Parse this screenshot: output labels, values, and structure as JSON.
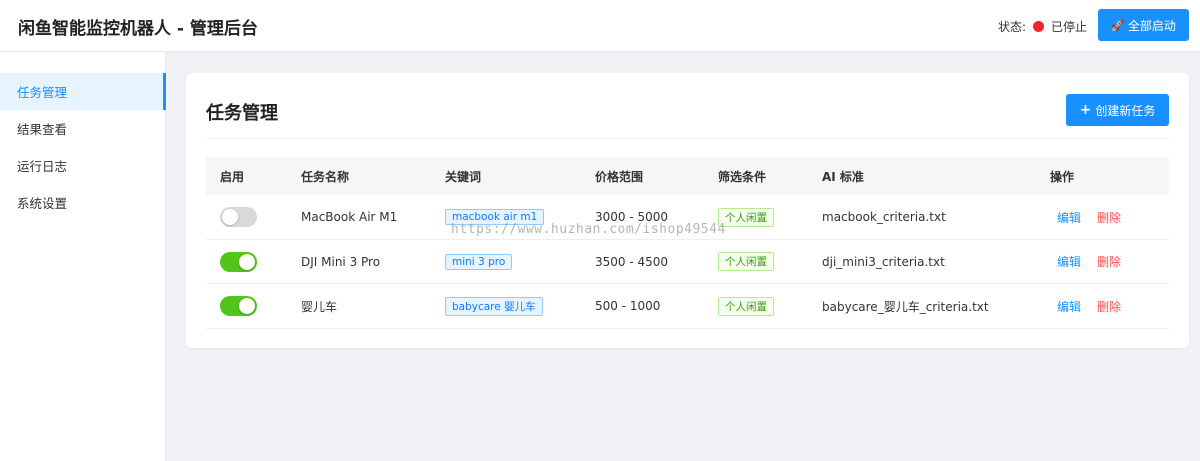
{
  "header": {
    "title": "闲鱼智能监控机器人 - 管理后台",
    "status_label": "状态:",
    "status_value": "已停止",
    "status_color": "#f5222d",
    "start_all_label": "全部启动",
    "start_all_icon": "rocket-icon"
  },
  "sidebar": {
    "items": [
      {
        "label": "任务管理",
        "active": true
      },
      {
        "label": "结果查看",
        "active": false
      },
      {
        "label": "运行日志",
        "active": false
      },
      {
        "label": "系统设置",
        "active": false
      }
    ]
  },
  "main": {
    "title": "任务管理",
    "create_label": "创建新任务",
    "create_icon": "plus-icon",
    "columns": [
      "启用",
      "任务名称",
      "关键词",
      "价格范围",
      "筛选条件",
      "AI 标准",
      "操作"
    ],
    "rows": [
      {
        "enabled": false,
        "name": "MacBook Air M1",
        "keyword": "macbook air m1",
        "price": "3000 - 5000",
        "filter": "个人闲置",
        "criteria": "macbook_criteria.txt",
        "edit": "编辑",
        "delete": "删除"
      },
      {
        "enabled": true,
        "name": "DJI Mini 3 Pro",
        "keyword": "mini 3 pro",
        "price": "3500 - 4500",
        "filter": "个人闲置",
        "criteria": "dji_mini3_criteria.txt",
        "edit": "编辑",
        "delete": "删除"
      },
      {
        "enabled": true,
        "name": "婴儿车",
        "keyword": "babycare 婴儿车",
        "price": "500 - 1000",
        "filter": "个人闲置",
        "criteria": "babycare_婴儿车_criteria.txt",
        "edit": "编辑",
        "delete": "删除"
      }
    ]
  },
  "watermark": "https://www.huzhan.com/ishop49544",
  "colors": {
    "accent": "#1890ff",
    "toggle_on": "#52c41a",
    "toggle_off": "#d9d9d9",
    "danger": "#ff4d4f"
  }
}
